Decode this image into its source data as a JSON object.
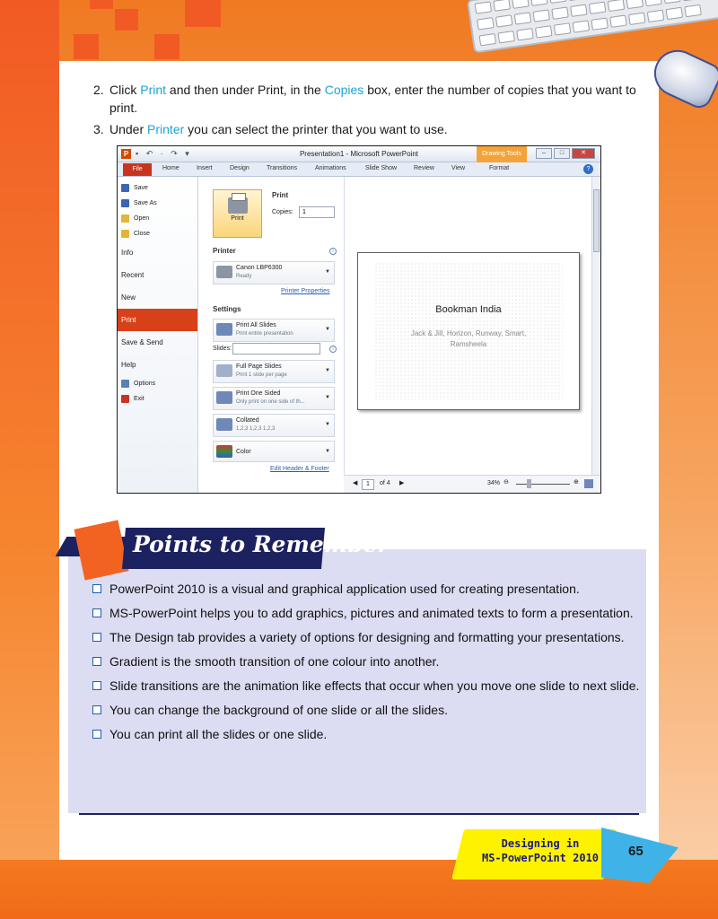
{
  "instructions": [
    {
      "num": "2.",
      "parts": [
        "Click ",
        "Print",
        " and then under Print, in the ",
        "Copies",
        " box, enter the number of copies that you want to print."
      ]
    },
    {
      "num": "3.",
      "parts": [
        "Under ",
        "Printer",
        " you can select the printer that you want to use."
      ]
    }
  ],
  "screenshot": {
    "window_title": "Presentation1 - Microsoft PowerPoint",
    "app_icon": "P",
    "contextual_tab": "Drawing Tools",
    "window_buttons": [
      "–",
      "□",
      "✕"
    ],
    "help_icon": "?",
    "ribbon_tabs": [
      "File",
      "Home",
      "Insert",
      "Design",
      "Transitions",
      "Animations",
      "Slide Show",
      "Review",
      "View",
      "Format"
    ],
    "backstage_small": [
      {
        "label": "Save",
        "icon": "save-icon",
        "color": "#3a66b5"
      },
      {
        "label": "Save As",
        "icon": "save-as-icon",
        "color": "#3a66b5"
      },
      {
        "label": "Open",
        "icon": "folder-open-icon",
        "color": "#e2b53b"
      },
      {
        "label": "Close",
        "icon": "folder-close-icon",
        "color": "#e2b53b"
      }
    ],
    "backstage_big": [
      "Info",
      "Recent",
      "New",
      "Print",
      "Save & Send",
      "Help"
    ],
    "backstage_active": "Print",
    "backstage_tail": [
      {
        "label": "Options",
        "icon": "options-icon",
        "color": "#5a7fb8"
      },
      {
        "label": "Exit",
        "icon": "exit-icon",
        "color": "#c9331e"
      }
    ],
    "print": {
      "section_title": "Print",
      "button_label": "Print",
      "copies_label": "Copies:",
      "copies_value": "1",
      "printer_title": "Printer",
      "printer_name": "Canon LBP6300",
      "printer_status": "Ready",
      "printer_properties": "Printer Properties",
      "settings_title": "Settings",
      "slides_label": "Slides:",
      "edit_header_footer": "Edit Header & Footer",
      "settings": [
        {
          "line1": "Print All Slides",
          "line2": "Print entire presentation",
          "color": "#6d88b9"
        },
        {
          "line1": "Full Page Slides",
          "line2": "Print 1 slide per page",
          "color": "#9fb0c9"
        },
        {
          "line1": "Print One Sided",
          "line2": "Only print on one side of th...",
          "color": "#6d88b9"
        },
        {
          "line1": "Collated",
          "line2": "1,2,3   1,2,3   1,2,3",
          "color": "#6d88b9"
        },
        {
          "line1": "Color",
          "line2": "",
          "color": "#3b8a3a"
        }
      ]
    },
    "preview": {
      "slide_title": "Bookman India",
      "slide_subtitle": "Jack & Jill, Horizon, Runway, Smart, Ramsheela",
      "page_current": "1",
      "page_of": "of 4",
      "zoom": "34%"
    }
  },
  "points_to_remember": {
    "title": "Points to Remember",
    "items": [
      "PowerPoint 2010 is a visual and graphical application used for creating presentation.",
      "MS-PowerPoint helps you to add graphics, pictures and animated texts to form a presentation.",
      "The Design tab provides a variety of options for designing and formatting your presentations.",
      "Gradient is the smooth transition of one colour into another.",
      "Slide transitions are the animation like effects that occur when you move one slide to next slide.",
      "You can change the background of one slide or all the slides.",
      "You can print all the slides or one slide."
    ]
  },
  "footer": {
    "chapter_line1": "Designing in",
    "chapter_line2": "MS-PowerPoint 2010",
    "page_number": "65"
  },
  "colors": {
    "highlight": "#1aa6d8",
    "accent_orange": "#f15a24",
    "navy": "#1c2160",
    "box_lavender": "#dcdcf2"
  }
}
